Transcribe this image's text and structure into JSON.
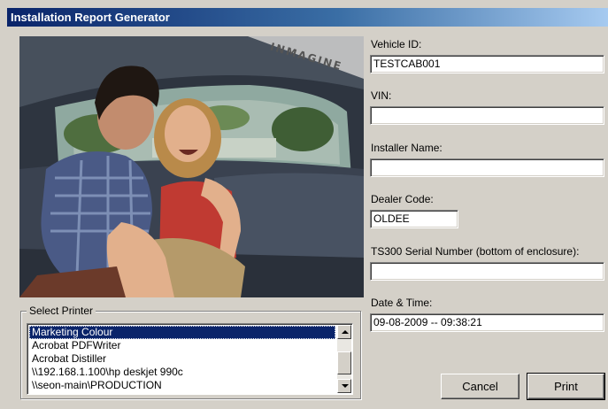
{
  "window": {
    "title": "Installation Report Generator"
  },
  "photo": {
    "watermark": "INMAGINE"
  },
  "fields": {
    "vehicle_id": {
      "label": "Vehicle ID:",
      "value": "TESTCAB001"
    },
    "vin": {
      "label": "VIN:",
      "value": ""
    },
    "installer_name": {
      "label": "Installer Name:",
      "value": ""
    },
    "dealer_code": {
      "label": "Dealer Code:",
      "value": "OLDEE"
    },
    "serial_number": {
      "label": "TS300 Serial Number (bottom of enclosure):",
      "value": ""
    },
    "date_time": {
      "label": "Date & Time:",
      "value": "09-08-2009 -- 09:38:21"
    }
  },
  "printer": {
    "group_label": "Select Printer",
    "items": [
      "Marketing Colour",
      "Acrobat PDFWriter",
      "Acrobat Distiller",
      "\\\\192.168.1.100\\hp deskjet 990c",
      "\\\\seon-main\\PRODUCTION"
    ],
    "selected": "Marketing Colour"
  },
  "buttons": {
    "cancel": "Cancel",
    "print": "Print"
  },
  "icons": {
    "scroll_up": "scroll-up-arrow-icon",
    "scroll_down": "scroll-down-arrow-icon"
  }
}
